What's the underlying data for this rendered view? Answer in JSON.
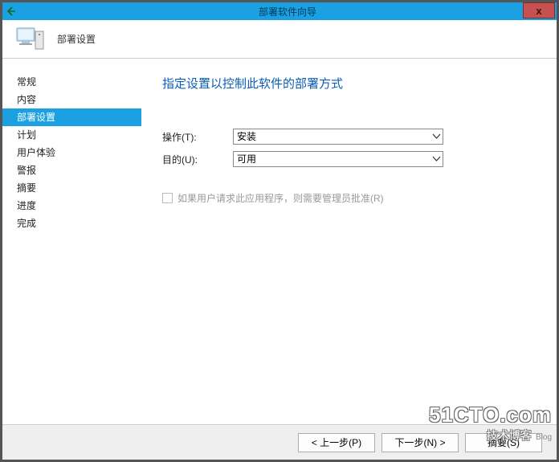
{
  "titlebar": {
    "title": "部署软件向导",
    "close_symbol": "x"
  },
  "header": {
    "section_title": "部署设置"
  },
  "sidebar": {
    "items": [
      {
        "label": "常规"
      },
      {
        "label": "内容"
      },
      {
        "label": "部署设置"
      },
      {
        "label": "计划"
      },
      {
        "label": "用户体验"
      },
      {
        "label": "警报"
      },
      {
        "label": "摘要"
      },
      {
        "label": "进度"
      },
      {
        "label": "完成"
      }
    ],
    "active_index": 2
  },
  "main": {
    "heading": "指定设置以控制此软件的部署方式",
    "rows": [
      {
        "label": "操作(T):",
        "value": "安装"
      },
      {
        "label": "目的(U):",
        "value": "可用"
      }
    ],
    "checkbox_label": "如果用户请求此应用程序，则需要管理员批准(R)"
  },
  "buttons": {
    "prev": "< 上一步(P)",
    "next": "下一步(N) >",
    "summary": "摘要(S)"
  },
  "watermark": {
    "big": "51CTO.com",
    "small": "技术博客",
    "tag": "Blog"
  }
}
